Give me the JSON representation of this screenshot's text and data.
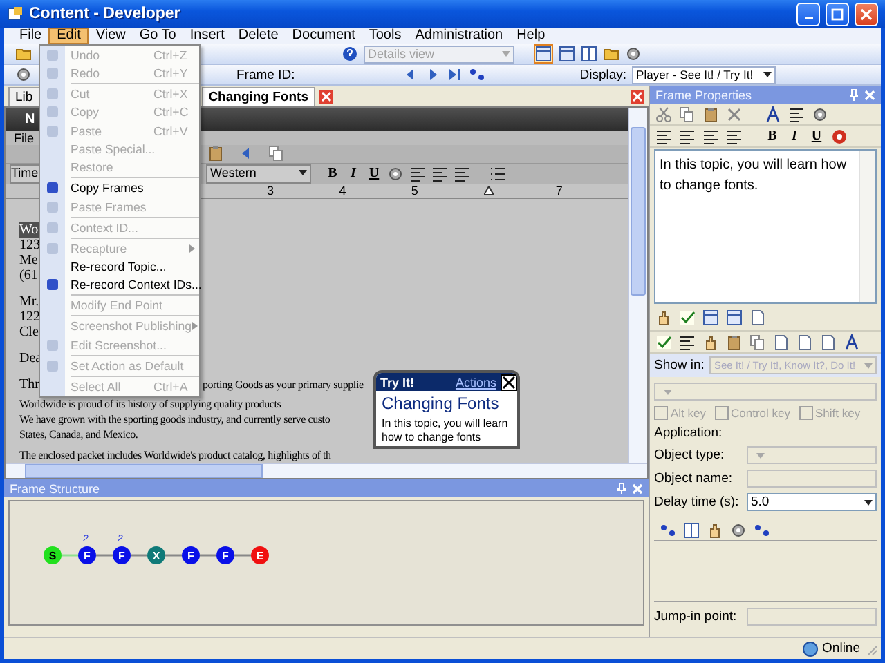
{
  "window": {
    "title": "Content - Developer"
  },
  "menu_bar": [
    {
      "label": "File",
      "selected": false
    },
    {
      "label": "Edit",
      "selected": true
    },
    {
      "label": "View",
      "selected": false
    },
    {
      "label": "Go To",
      "selected": false
    },
    {
      "label": "Insert",
      "selected": false
    },
    {
      "label": "Delete",
      "selected": false
    },
    {
      "label": "Document",
      "selected": false
    },
    {
      "label": "Tools",
      "selected": false
    },
    {
      "label": "Administration",
      "selected": false
    },
    {
      "label": "Help",
      "selected": false
    }
  ],
  "toolbar": {
    "view_dropdown": {
      "value": "Details view",
      "disabled": true
    }
  },
  "frame_toolbar": {
    "frame_id_label": "Frame ID:",
    "display_label": "Display:",
    "display_value": "Player - See It! / Try It!"
  },
  "edit_menu": [
    {
      "kind": "item",
      "label": "Undo",
      "shortcut": "Ctrl+Z",
      "disabled": true,
      "icon": true,
      "submenu": false
    },
    {
      "kind": "item",
      "label": "Redo",
      "shortcut": "Ctrl+Y",
      "disabled": true,
      "icon": true,
      "submenu": false
    },
    {
      "kind": "separator"
    },
    {
      "kind": "item",
      "label": "Cut",
      "shortcut": "Ctrl+X",
      "disabled": true,
      "icon": true,
      "submenu": false
    },
    {
      "kind": "item",
      "label": "Copy",
      "shortcut": "Ctrl+C",
      "disabled": true,
      "icon": true,
      "submenu": false
    },
    {
      "kind": "item",
      "label": "Paste",
      "shortcut": "Ctrl+V",
      "disabled": true,
      "icon": true,
      "submenu": false
    },
    {
      "kind": "item",
      "label": "Paste Special...",
      "disabled": true,
      "icon": false,
      "submenu": false
    },
    {
      "kind": "item",
      "label": "Restore",
      "disabled": true,
      "icon": false,
      "submenu": false
    },
    {
      "kind": "separator"
    },
    {
      "kind": "item",
      "label": "Copy Frames",
      "disabled": false,
      "icon": true,
      "submenu": false
    },
    {
      "kind": "item",
      "label": "Paste Frames",
      "disabled": true,
      "icon": true,
      "submenu": false
    },
    {
      "kind": "separator"
    },
    {
      "kind": "item",
      "label": "Context ID...",
      "disabled": true,
      "icon": true,
      "submenu": false
    },
    {
      "kind": "separator"
    },
    {
      "kind": "item",
      "label": "Recapture",
      "disabled": true,
      "icon": true,
      "submenu": true
    },
    {
      "kind": "item",
      "label": "Re-record Topic...",
      "disabled": false,
      "icon": false,
      "submenu": false
    },
    {
      "kind": "item",
      "label": "Re-record Context IDs...",
      "disabled": false,
      "icon": true,
      "submenu": false
    },
    {
      "kind": "separator"
    },
    {
      "kind": "item",
      "label": "Modify End Point",
      "disabled": true,
      "icon": false,
      "submenu": false
    },
    {
      "kind": "separator"
    },
    {
      "kind": "item",
      "label": "Screenshot Publishing",
      "disabled": true,
      "icon": false,
      "submenu": true
    },
    {
      "kind": "item",
      "label": "Edit Screenshot...",
      "disabled": true,
      "icon": true,
      "submenu": false
    },
    {
      "kind": "separator"
    },
    {
      "kind": "item",
      "label": "Set Action as Default",
      "disabled": true,
      "icon": true,
      "submenu": false
    },
    {
      "kind": "separator"
    },
    {
      "kind": "item",
      "label": "Select All",
      "shortcut": "Ctrl+A",
      "disabled": true,
      "icon": false,
      "submenu": false
    }
  ],
  "tabs": [
    {
      "label": "Lib",
      "selected": false,
      "closable": false
    },
    {
      "label": "Changing Fonts",
      "selected": true,
      "closable": true
    }
  ],
  "embedded_app": {
    "title": "N",
    "menu": [
      "File"
    ],
    "font_name": "Time",
    "charset": "Western",
    "format_buttons": [
      "B",
      "I",
      "U"
    ],
    "ruler_numbers": [
      "3",
      "4",
      "5",
      "7"
    ],
    "address_blocks": [
      [
        {
          "text": "Wo",
          "highlighted": true
        },
        {
          "text": "123",
          "highlighted": false
        },
        {
          "text": "Me",
          "highlighted": false
        },
        {
          "text": "(61",
          "highlighted": false
        }
      ],
      [
        {
          "text": "Mr.",
          "highlighted": false
        },
        {
          "text": "122",
          "highlighted": false
        },
        {
          "text": "Cle",
          "highlighted": false
        }
      ],
      [
        {
          "text": "Dea",
          "highlighted": false
        }
      ]
    ],
    "split_line": {
      "left": "Thr",
      "right": "porting Goods as your primary supplie"
    },
    "paragraphs": [
      [
        "Worldwide is proud of its history of supplying quality products",
        "We have grown with the sporting goods industry, and currently serve custo",
        "States, Canada, and Mexico."
      ],
      [
        "The enclosed packet includes Worldwide's product catalog, highlights of th"
      ]
    ]
  },
  "try_it": {
    "heading": "Try It!",
    "link": "Actions",
    "title": "Changing Fonts",
    "text": "In this topic, you will learn how to change fonts"
  },
  "frame_structure": {
    "title": "Frame Structure",
    "nodes": [
      {
        "label": "S",
        "color": "#22e01e"
      },
      {
        "label": "F",
        "color": "#0a10e8",
        "count": "2"
      },
      {
        "label": "F",
        "color": "#0a10e8",
        "count": "2"
      },
      {
        "label": "X",
        "color": "#0f7a78"
      },
      {
        "label": "F",
        "color": "#0a10e8"
      },
      {
        "label": "F",
        "color": "#0a10e8"
      },
      {
        "label": "E",
        "color": "#f01010"
      }
    ]
  },
  "frame_properties": {
    "title": "Frame Properties",
    "format_buttons": [
      "B",
      "I",
      "U"
    ],
    "text": "In this topic, you will learn how to change fonts.",
    "show_in": {
      "label": "Show in:",
      "value": "See It! / Try It!, Know It?, Do It!",
      "disabled": true
    },
    "action_dropdown": {
      "disabled": true
    },
    "checkboxes": [
      {
        "label": "Alt key",
        "checked": false,
        "disabled": true
      },
      {
        "label": "Control key",
        "checked": false,
        "disabled": true
      },
      {
        "label": "Shift key",
        "checked": false,
        "disabled": true
      }
    ],
    "application_label": "Application:",
    "fields": [
      {
        "label": "Object type:",
        "kind": "dropdown",
        "disabled": true
      },
      {
        "label": "Object name:",
        "kind": "text",
        "disabled": true
      },
      {
        "label": "Delay time (s):",
        "kind": "dropdown",
        "value": "5.0",
        "disabled": false
      }
    ],
    "jump_in": {
      "label": "Jump-in point:",
      "disabled": true
    }
  },
  "status_bar": {
    "connection": "Online"
  }
}
